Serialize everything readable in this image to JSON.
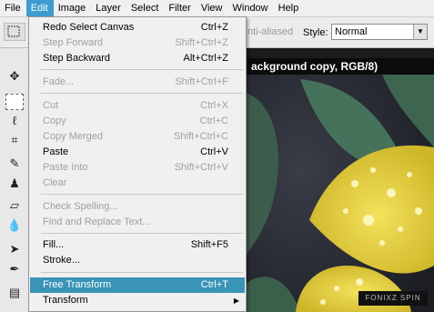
{
  "menubar": {
    "items": [
      "File",
      "Edit",
      "Image",
      "Layer",
      "Select",
      "Filter",
      "View",
      "Window",
      "Help"
    ],
    "active": "Edit"
  },
  "options": {
    "anti_aliased": "nti-aliased",
    "style_label": "Style:",
    "style_value": "Normal"
  },
  "document": {
    "title": "ackground copy, RGB/8)",
    "credit": "FONIXZ SPIN"
  },
  "edit_menu": [
    {
      "label": "Redo Select Canvas",
      "shortcut": "Ctrl+Z",
      "enabled": true
    },
    {
      "label": "Step Forward",
      "shortcut": "Shift+Ctrl+Z",
      "enabled": false
    },
    {
      "label": "Step Backward",
      "shortcut": "Alt+Ctrl+Z",
      "enabled": true
    },
    {
      "label": "Fade...",
      "shortcut": "Shift+Ctrl+F",
      "enabled": false
    },
    {
      "label": "Cut",
      "shortcut": "Ctrl+X",
      "enabled": false
    },
    {
      "label": "Copy",
      "shortcut": "Ctrl+C",
      "enabled": false
    },
    {
      "label": "Copy Merged",
      "shortcut": "Shift+Ctrl+C",
      "enabled": false
    },
    {
      "label": "Paste",
      "shortcut": "Ctrl+V",
      "enabled": true
    },
    {
      "label": "Paste Into",
      "shortcut": "Shift+Ctrl+V",
      "enabled": false
    },
    {
      "label": "Clear",
      "shortcut": "",
      "enabled": false
    },
    {
      "label": "Check Spelling...",
      "shortcut": "",
      "enabled": false
    },
    {
      "label": "Find and Replace Text...",
      "shortcut": "",
      "enabled": false
    },
    {
      "label": "Fill...",
      "shortcut": "Shift+F5",
      "enabled": true
    },
    {
      "label": "Stroke...",
      "shortcut": "",
      "enabled": true
    },
    {
      "label": "Free Transform",
      "shortcut": "Ctrl+T",
      "enabled": true,
      "highlighted": true
    },
    {
      "label": "Transform",
      "shortcut": "",
      "enabled": true,
      "submenu": true
    }
  ],
  "tools": [
    "move-tool-icon",
    "marquee-tool-icon",
    "lasso-tool-icon",
    "crop-tool-icon",
    "healing-brush-icon",
    "stamp-tool-icon",
    "eraser-tool-icon",
    "blur-tool-icon",
    "path-select-icon",
    "pen-tool-icon",
    "notes-tool-icon"
  ],
  "colors": {
    "menu_highlight": "#3a94b7",
    "menubar_active": "#3d9dd0",
    "flower": "#e6d23a",
    "leaf": "#3f6a52"
  }
}
